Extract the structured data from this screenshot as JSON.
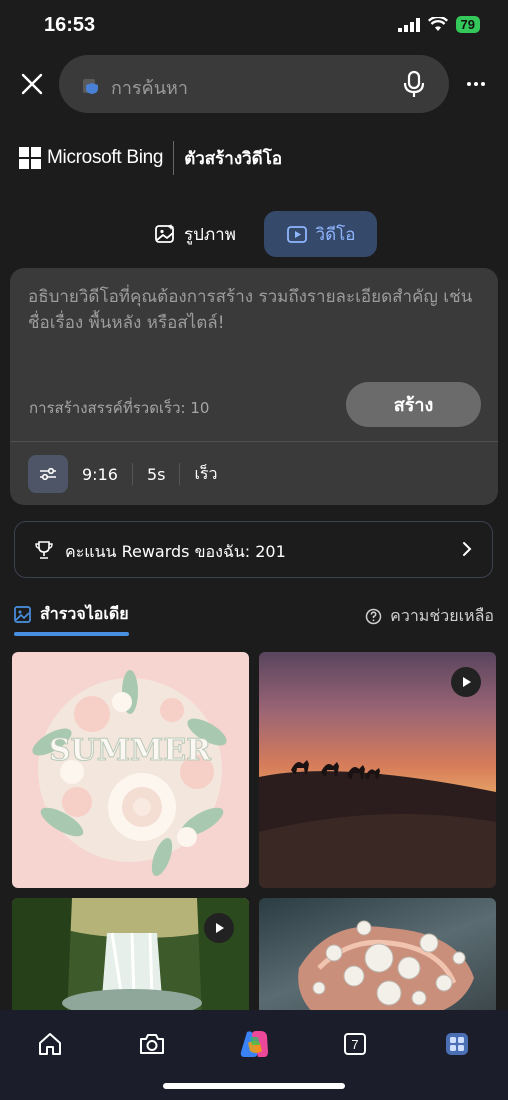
{
  "status": {
    "time": "16:53",
    "battery": "79"
  },
  "search": {
    "placeholder": "การค้นหา"
  },
  "brand": {
    "name": "Microsoft Bing",
    "product": "ตัวสร้างวิดีโอ"
  },
  "mode_tabs": [
    {
      "label": "รูปภาพ",
      "icon": "image-icon",
      "active": false
    },
    {
      "label": "วิดีโอ",
      "icon": "video-icon",
      "active": true
    }
  ],
  "prompt": {
    "placeholder": "อธิบายวิดีโอที่คุณต้องการสร้าง รวมถึงรายละเอียดสำคัญ เช่น ชื่อเรื่อง พื้นหลัง หรือสไตล์!",
    "boosts_label": "การสร้างสรรค์ที่รวดเร็ว: 10",
    "create_label": "สร้าง",
    "options": {
      "aspect": "9:16",
      "duration": "5s",
      "speed": "เร็ว"
    }
  },
  "rewards": {
    "label": "คะแนน Rewards ของฉัน: 201"
  },
  "explore": {
    "tab_label": "สำรวจไอเดีย",
    "help_label": "ความช่วยเหลือ"
  },
  "gallery": [
    {
      "type": "image",
      "caption_art": "SUMMER"
    },
    {
      "type": "video"
    },
    {
      "type": "video"
    },
    {
      "type": "image"
    }
  ],
  "bottom_nav": {
    "tabs_count": "7"
  },
  "colors": {
    "accent": "#4a90e2",
    "active_tab_bg": "#35496b",
    "background": "#1c1c1c"
  }
}
